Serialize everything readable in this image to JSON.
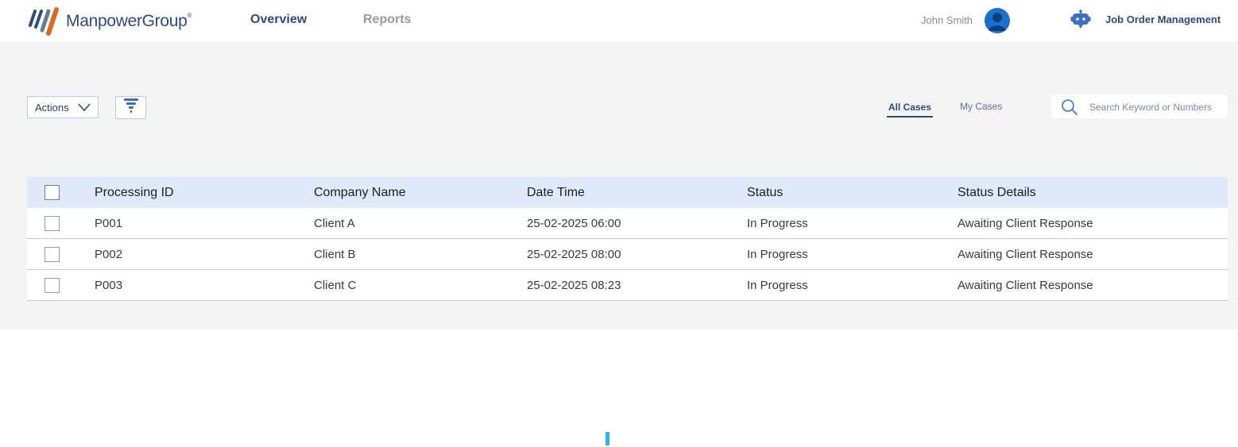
{
  "header": {
    "brand": "ManpowerGroup",
    "brand_mark": "®",
    "nav": {
      "overview": "Overview",
      "reports": "Reports"
    },
    "user_name": "John Smith",
    "app_title": "Job Order Management"
  },
  "toolbar": {
    "actions_label": "Actions",
    "tabs": {
      "all_cases": "All Cases",
      "my_cases": "My Cases"
    },
    "search_placeholder": "Search Keyword or Numbers"
  },
  "table": {
    "columns": {
      "processing_id": "Processing ID",
      "company_name": "Company Name",
      "date_time": "Date Time",
      "status": "Status",
      "status_details": "Status Details"
    },
    "rows": [
      {
        "processing_id": "P001",
        "company_name": "Client A",
        "date_time": "25-02-2025 06:00",
        "status": "In Progress",
        "status_details": "Awaiting Client Response"
      },
      {
        "processing_id": "P002",
        "company_name": "Client B",
        "date_time": "25-02-2025 08:00",
        "status": "In Progress",
        "status_details": "Awaiting Client Response"
      },
      {
        "processing_id": "P003",
        "company_name": "Client C",
        "date_time": "25-02-2025 08:23",
        "status": "In Progress",
        "status_details": "Awaiting Client Response"
      }
    ]
  },
  "colors": {
    "brand_navy": "#2f4a7d",
    "header_row": "#deeafa",
    "page_bg": "#f4f4f4",
    "avatar": "#1b6fd0",
    "loader": "#29b6f0"
  },
  "icons": {
    "logo": "manpowergroup-logo-icon",
    "avatar": "user-avatar-icon",
    "bot": "robot-icon",
    "chevron": "chevron-down-icon",
    "filter": "filter-funnel-icon",
    "search": "search-icon"
  }
}
